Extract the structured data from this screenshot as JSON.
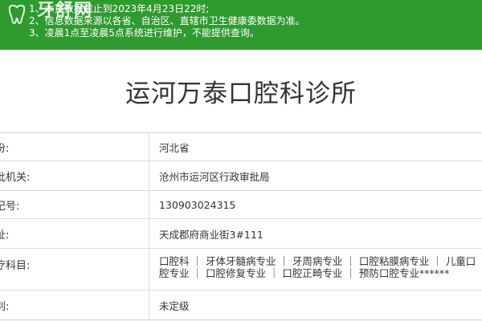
{
  "banner": {
    "logo_text": "牙舒网",
    "lines": [
      "1、本页数据截止到2023年4月23日22时;",
      "2、信息数据来源以各省、自治区、直辖市卫生健康委数据为准。",
      "3、凌晨1点至凌晨5点系统进行维护，不能提供查询。"
    ],
    "background_color": "#2f9a2f"
  },
  "page": {
    "title": "运河万泰口腔科诊所"
  },
  "details": [
    {
      "label": "份:",
      "value": "河北省"
    },
    {
      "label": "批机关:",
      "value": "沧州市运河区行政审批局"
    },
    {
      "label": "记号:",
      "value": "130903024315"
    },
    {
      "label": "址:",
      "value": "天成郡府商业街3#111"
    },
    {
      "label": "疗科目:",
      "value": "口腔科 ｜ 牙体牙髓病专业 ｜ 牙周病专业 ｜ 口腔粘膜病专业 ｜ 儿童口腔专业 ｜ 口腔修复专业 ｜ 口腔正畸专业 ｜ 预防口腔专业******"
    },
    {
      "label": "别:",
      "value": "未定级"
    }
  ]
}
